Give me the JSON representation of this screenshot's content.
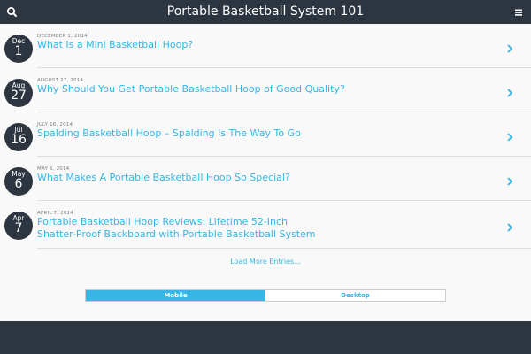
{
  "header": {
    "title": "Portable Basketball System 101"
  },
  "posts": [
    {
      "month": "Dec",
      "day": "1",
      "date": "DECEMBER 1, 2014",
      "title": "What Is a Mini Basketball Hoop?"
    },
    {
      "month": "Aug",
      "day": "27",
      "date": "AUGUST 27, 2014",
      "title": "Why Should You Get Portable Basketball Hoop of Good Quality?"
    },
    {
      "month": "Jul",
      "day": "16",
      "date": "JULY 16, 2014",
      "title": "Spalding Basketball Hoop – Spalding Is The Way To Go"
    },
    {
      "month": "May",
      "day": "6",
      "date": "MAY 6, 2014",
      "title": "What Makes A Portable Basketball Hoop So Special?"
    },
    {
      "month": "Apr",
      "day": "7",
      "date": "APRIL 7, 2014",
      "title": "Portable Basketball Hoop Reviews: Lifetime 52-Inch Shatter-Proof Backboard with Portable Basketball System"
    }
  ],
  "load_more": "Load More Entries...",
  "view_switch": {
    "mobile": "Mobile",
    "desktop": "Desktop",
    "selected": "Mobile"
  },
  "colors": {
    "dark": "#2d3540",
    "accent": "#35b6e5",
    "content_bg": "#f9f9f9"
  },
  "icons": {
    "search": "search-icon",
    "menu": "hamburger-menu-icon",
    "chevron": "chevron-right-icon"
  }
}
